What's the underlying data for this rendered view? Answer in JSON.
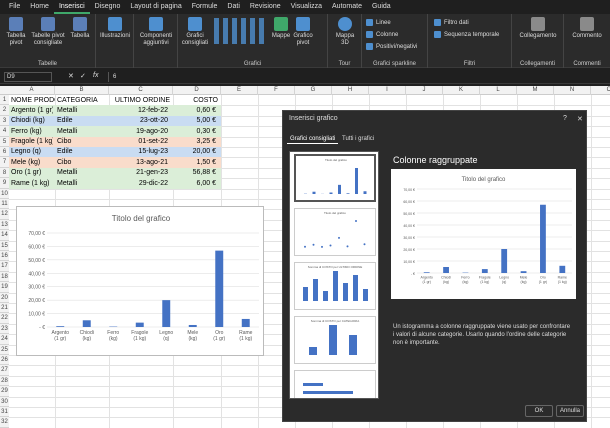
{
  "menu": [
    "File",
    "Home",
    "Inserisci",
    "Disegno",
    "Layout di pagina",
    "Formule",
    "Dati",
    "Revisione",
    "Visualizza",
    "Automate",
    "Guida"
  ],
  "menu_active": 2,
  "ribbon": {
    "tables": {
      "b1": "Tabella pivot",
      "b2": "Tabelle pivot consigliate",
      "b3": "Tabella",
      "label": "Tabelle"
    },
    "illus": {
      "b1": "Illustrazioni"
    },
    "addins": {
      "b1": "Componenti aggiuntivi"
    },
    "charts": {
      "b1": "Grafici consigliati",
      "b2": "Mappe",
      "b3": "Grafico pivot",
      "b4": "Mappa 3D",
      "label": "Grafici",
      "tour": "Tour"
    },
    "spark": {
      "s1": "Linee",
      "s2": "Colonne",
      "s3": "Positivi/negativi",
      "label": "Grafici sparkline"
    },
    "filters": {
      "s1": "Filtro dati",
      "s2": "Sequenza temporale",
      "label": "Filtri"
    },
    "links": {
      "b1": "Collegamento",
      "label": "Collegamenti"
    },
    "comments": {
      "b1": "Commento",
      "label": "Commenti"
    }
  },
  "formula": {
    "namebox": "D9",
    "value": "6"
  },
  "columns": [
    "A",
    "B",
    "C",
    "D",
    "E",
    "F",
    "G",
    "H",
    "I",
    "J",
    "K",
    "L",
    "M",
    "N",
    "O"
  ],
  "rows": [
    "1",
    "2",
    "3",
    "4",
    "5",
    "6",
    "7",
    "8",
    "9",
    "10",
    "11",
    "12",
    "13",
    "14",
    "15",
    "16",
    "17",
    "18",
    "19",
    "20",
    "21",
    "22",
    "23",
    "24",
    "25",
    "26",
    "27",
    "28",
    "29",
    "30",
    "31",
    "32"
  ],
  "table": {
    "headers": [
      "NOME PRODOTTO",
      "CATEGORIA",
      "ULTIMO ORDINE",
      "COSTO"
    ],
    "rows": [
      [
        "Argento (1 gr)",
        "Metalli",
        "12-feb-22",
        "0,60 €"
      ],
      [
        "Chiodi (kg)",
        "Edile",
        "23-ott-20",
        "5,00 €"
      ],
      [
        "Ferro (kg)",
        "Metalli",
        "19-ago-20",
        "0,30 €"
      ],
      [
        "Fragole (1 kg)",
        "Cibo",
        "01-set-22",
        "3,25 €"
      ],
      [
        "Legno (q)",
        "Edile",
        "15-lug-23",
        "20,00 €"
      ],
      [
        "Mele (kg)",
        "Cibo",
        "13-ago-21",
        "1,50 €"
      ],
      [
        "Oro (1 gr)",
        "Metalli",
        "21-gen-23",
        "56,88 €"
      ],
      [
        "Rame (1 kg)",
        "Metalli",
        "29-dic-22",
        "6,00 €"
      ]
    ],
    "row_colors": [
      "#dbeed8",
      "#c9dcf2",
      "#dbeed8",
      "#f9dccb",
      "#c9dcf2",
      "#f9dccb",
      "#dbeed8",
      "#dbeed8"
    ]
  },
  "chart_data": {
    "type": "bar",
    "title": "Titolo del grafico",
    "categories": [
      "Argento (1 gr)",
      "Chiodi (kg)",
      "Ferro (kg)",
      "Fragole (1 kg)",
      "Legno (q)",
      "Mele (kg)",
      "Oro (1 gr)",
      "Rame (1 kg)"
    ],
    "values": [
      0.6,
      5.0,
      0.3,
      3.25,
      20.0,
      1.5,
      56.88,
      6.0
    ],
    "ylim": [
      0,
      70
    ],
    "yticks": [
      "- €",
      "10,00 €",
      "20,00 €",
      "30,00 €",
      "40,00 €",
      "50,00 €",
      "60,00 €",
      "70,00 €"
    ],
    "bar_color": "#4472c4"
  },
  "dialog": {
    "title": "Inserisci grafico",
    "help": "?",
    "close": "✕",
    "tab1": "Grafici consigliati",
    "tab2": "Tutti i grafici",
    "preview_title": "Colonne raggruppate",
    "preview_chart_title": "Titolo del grafico",
    "description": "Un istogramma a colonne raggruppate viene usato per confrontare i valori di alcune categorie. Usarlo quando l'ordine delle categorie non è importante.",
    "thumb_captions": [
      "Titolo del grafico",
      "Titolo del grafico",
      "Somma di COSTO per ULTIMO ORDINE",
      "Somma di COSTO per CATEGORIA"
    ],
    "ok": "OK",
    "cancel": "Annulla"
  }
}
